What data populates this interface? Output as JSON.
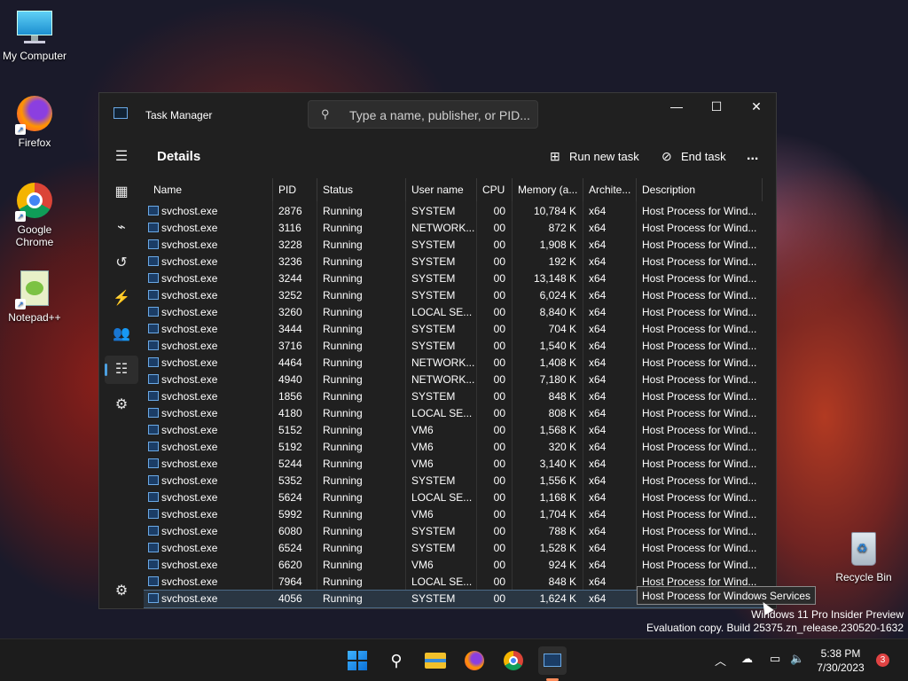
{
  "desktop": {
    "icons": [
      {
        "label": "My Computer"
      },
      {
        "label": "Firefox"
      },
      {
        "label": "Google Chrome"
      },
      {
        "label": "Notepad++"
      },
      {
        "label": "Recycle Bin"
      }
    ]
  },
  "window": {
    "title": "Task Manager",
    "search_placeholder": "Type a name, publisher, or PID...",
    "page_title": "Details",
    "run_new_task": "Run new task",
    "end_task": "End task",
    "more": "...",
    "columns": [
      "Name",
      "PID",
      "Status",
      "User name",
      "CPU",
      "Memory (a...",
      "Archite...",
      "Description"
    ],
    "rows": [
      [
        "svchost.exe",
        "2876",
        "Running",
        "SYSTEM",
        "00",
        "10,784 K",
        "x64",
        "Host Process for Wind..."
      ],
      [
        "svchost.exe",
        "3116",
        "Running",
        "NETWORK...",
        "00",
        "872 K",
        "x64",
        "Host Process for Wind..."
      ],
      [
        "svchost.exe",
        "3228",
        "Running",
        "SYSTEM",
        "00",
        "1,908 K",
        "x64",
        "Host Process for Wind..."
      ],
      [
        "svchost.exe",
        "3236",
        "Running",
        "SYSTEM",
        "00",
        "192 K",
        "x64",
        "Host Process for Wind..."
      ],
      [
        "svchost.exe",
        "3244",
        "Running",
        "SYSTEM",
        "00",
        "13,148 K",
        "x64",
        "Host Process for Wind..."
      ],
      [
        "svchost.exe",
        "3252",
        "Running",
        "SYSTEM",
        "00",
        "6,024 K",
        "x64",
        "Host Process for Wind..."
      ],
      [
        "svchost.exe",
        "3260",
        "Running",
        "LOCAL SE...",
        "00",
        "8,840 K",
        "x64",
        "Host Process for Wind..."
      ],
      [
        "svchost.exe",
        "3444",
        "Running",
        "SYSTEM",
        "00",
        "704 K",
        "x64",
        "Host Process for Wind..."
      ],
      [
        "svchost.exe",
        "3716",
        "Running",
        "SYSTEM",
        "00",
        "1,540 K",
        "x64",
        "Host Process for Wind..."
      ],
      [
        "svchost.exe",
        "4464",
        "Running",
        "NETWORK...",
        "00",
        "1,408 K",
        "x64",
        "Host Process for Wind..."
      ],
      [
        "svchost.exe",
        "4940",
        "Running",
        "NETWORK...",
        "00",
        "7,180 K",
        "x64",
        "Host Process for Wind..."
      ],
      [
        "svchost.exe",
        "1856",
        "Running",
        "SYSTEM",
        "00",
        "848 K",
        "x64",
        "Host Process for Wind..."
      ],
      [
        "svchost.exe",
        "4180",
        "Running",
        "LOCAL SE...",
        "00",
        "808 K",
        "x64",
        "Host Process for Wind..."
      ],
      [
        "svchost.exe",
        "5152",
        "Running",
        "VM6",
        "00",
        "1,568 K",
        "x64",
        "Host Process for Wind..."
      ],
      [
        "svchost.exe",
        "5192",
        "Running",
        "VM6",
        "00",
        "320 K",
        "x64",
        "Host Process for Wind..."
      ],
      [
        "svchost.exe",
        "5244",
        "Running",
        "VM6",
        "00",
        "3,140 K",
        "x64",
        "Host Process for Wind..."
      ],
      [
        "svchost.exe",
        "5352",
        "Running",
        "SYSTEM",
        "00",
        "1,556 K",
        "x64",
        "Host Process for Wind..."
      ],
      [
        "svchost.exe",
        "5624",
        "Running",
        "LOCAL SE...",
        "00",
        "1,168 K",
        "x64",
        "Host Process for Wind..."
      ],
      [
        "svchost.exe",
        "5992",
        "Running",
        "VM6",
        "00",
        "1,704 K",
        "x64",
        "Host Process for Wind..."
      ],
      [
        "svchost.exe",
        "6080",
        "Running",
        "SYSTEM",
        "00",
        "788 K",
        "x64",
        "Host Process for Wind..."
      ],
      [
        "svchost.exe",
        "6524",
        "Running",
        "SYSTEM",
        "00",
        "1,528 K",
        "x64",
        "Host Process for Wind..."
      ],
      [
        "svchost.exe",
        "6620",
        "Running",
        "VM6",
        "00",
        "924 K",
        "x64",
        "Host Process for Wind..."
      ],
      [
        "svchost.exe",
        "7964",
        "Running",
        "LOCAL SE...",
        "00",
        "848 K",
        "x64",
        "Host Process for Wind..."
      ],
      [
        "svchost.exe",
        "4056",
        "Running",
        "SYSTEM",
        "00",
        "1,624 K",
        "x64",
        "Host Process for Wind..."
      ]
    ],
    "selected_row": 23,
    "tooltip": "Host Process for Windows Services"
  },
  "watermark": {
    "line1": "Windows 11 Pro Insider Preview",
    "line2": "Evaluation copy. Build 25375.zn_release.230520-1632"
  },
  "taskbar": {
    "time": "5:38 PM",
    "date": "7/30/2023",
    "notifications": "3"
  }
}
